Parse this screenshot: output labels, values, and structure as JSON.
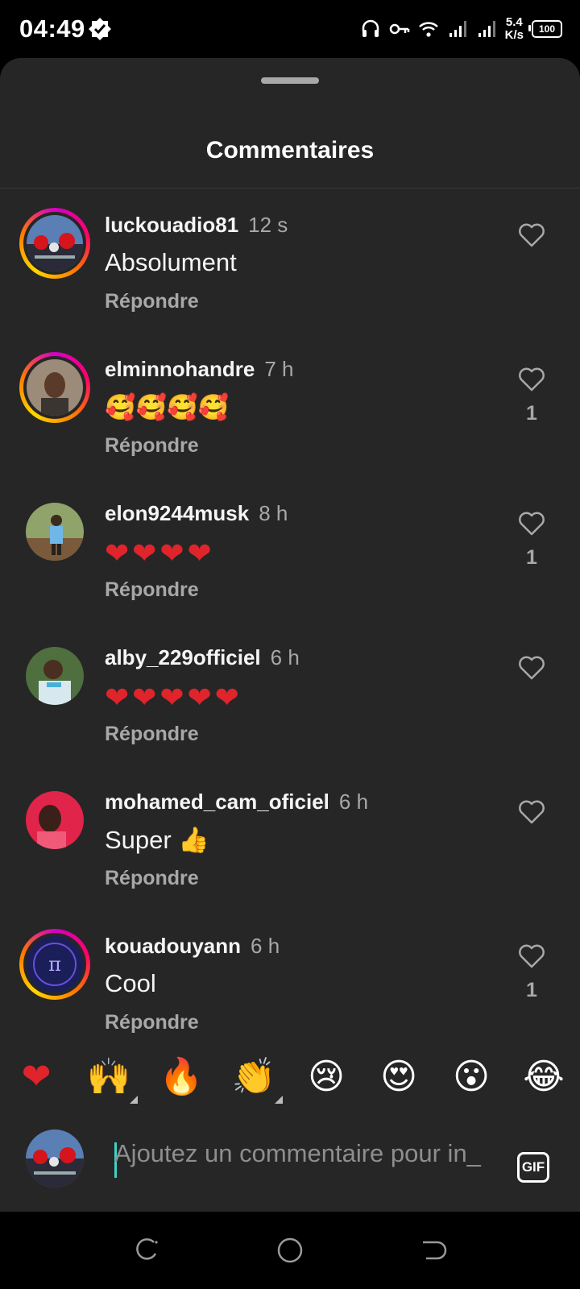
{
  "status_bar": {
    "time": "04:49",
    "net_speed_value": "5.4",
    "net_speed_unit": "K/s",
    "battery": "100",
    "icons": [
      "verified-check-icon",
      "headset-icon",
      "vpn-key-icon",
      "wifi-icon",
      "signal-icon",
      "signal-icon",
      "battery-icon"
    ]
  },
  "sheet": {
    "title": "Commentaires"
  },
  "comments": [
    {
      "username": "luckouadio81",
      "time": "12 s",
      "text": "Absolument",
      "reply": "Répondre",
      "likes": "",
      "ring": true
    },
    {
      "username": "elminnohandre",
      "time": "7 h",
      "text": "🥰🥰🥰🥰",
      "reply": "Répondre",
      "likes": "1",
      "ring": true
    },
    {
      "username": "elon9244musk",
      "time": "8 h",
      "text": "❤❤❤❤",
      "reply": "Répondre",
      "likes": "1",
      "ring": false
    },
    {
      "username": "alby_229officiel",
      "time": "6 h",
      "text": "❤❤❤❤❤",
      "reply": "Répondre",
      "likes": "",
      "ring": false
    },
    {
      "username": "mohamed_cam_oficiel",
      "time": "6 h",
      "text": "Super 👍",
      "reply": "Répondre",
      "likes": "",
      "ring": false
    },
    {
      "username": "kouadouyann",
      "time": "6 h",
      "text": "Cool",
      "reply": "Répondre",
      "likes": "1",
      "ring": true
    }
  ],
  "reactions": [
    "❤",
    "🙌",
    "🔥",
    "👏",
    "😢",
    "😍",
    "😮",
    "😂"
  ],
  "composer": {
    "placeholder": "Ajoutez un commentaire pour in_",
    "gif_label": "GIF"
  },
  "colors": {
    "sheet_bg": "#262626",
    "secondary_text": "#a8a8a8",
    "heart_red": "#e0242c",
    "caret": "#3fd1c7"
  }
}
